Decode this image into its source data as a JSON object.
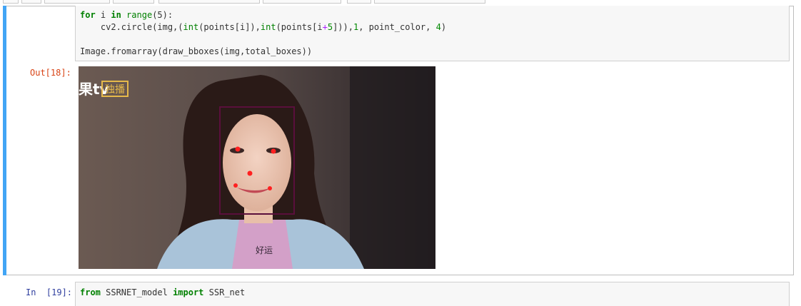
{
  "code_lines": {
    "l1_kw_for": "for",
    "l1_var": " i ",
    "l1_kw_in": "in",
    "l1_builtin": " range",
    "l1_rest": "(5):",
    "l2_prefix": "    cv2.circle(img,(",
    "l2_int1": "int",
    "l2_mid1": "(points[i]),",
    "l2_int2": "int",
    "l2_mid2": "(points[i",
    "l2_plus": "+",
    "l2_num5": "5",
    "l2_mid3": "])),",
    "l2_num1": "1",
    "l2_mid4": ", point_color, ",
    "l2_num4": "4",
    "l2_end": ")",
    "l4": "Image.fromarray(draw_bboxes(img,total_boxes))"
  },
  "output_prompt": "Out[18]:",
  "image": {
    "watermark_text": "果tv",
    "badge_text": "独播",
    "shirt_text": "好运",
    "bbox_color": "#5a0f3c",
    "landmark_color": "#ff2020"
  },
  "next_cell": {
    "prompt": "In  [19]:",
    "kw_from": "from",
    "module": " SSRNET_model ",
    "kw_import": "import",
    "name": " SSR_net"
  },
  "colors": {
    "selected_bar": "#42a5f5",
    "out_prompt": "#d84315",
    "in_prompt": "#303f9f"
  }
}
